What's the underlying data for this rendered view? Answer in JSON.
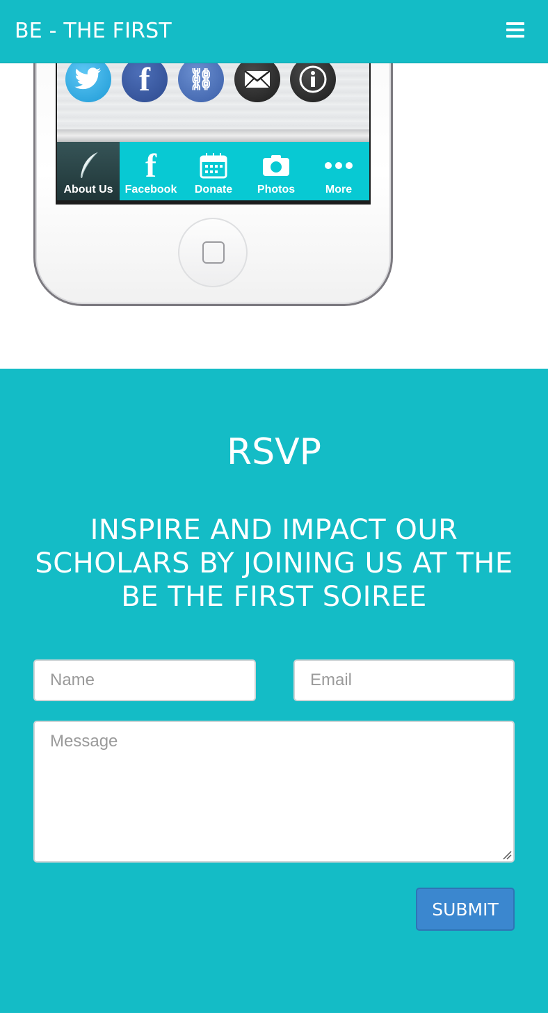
{
  "navbar": {
    "brand": "BE - THE FIRST",
    "menu_icon": "hamburger-menu-icon",
    "background": "#14bcc6"
  },
  "phone": {
    "share_icons": [
      "twitter-icon",
      "facebook-icon",
      "link-icon",
      "mail-icon",
      "info-icon"
    ],
    "tabs": [
      {
        "label": "About Us",
        "icon": "feather-icon",
        "active": true
      },
      {
        "label": "Facebook",
        "icon": "facebook-f-icon",
        "active": false
      },
      {
        "label": "Donate",
        "icon": "calendar-icon",
        "active": false
      },
      {
        "label": "Photos",
        "icon": "camera-icon",
        "active": false
      },
      {
        "label": "More",
        "icon": "more-dots-icon",
        "active": false
      }
    ]
  },
  "rsvp": {
    "title": "RSVP",
    "subtitle": "INSPIRE AND IMPACT OUR SCHOLARS BY JOINING US AT THE BE THE FIRST SOIREE",
    "name_placeholder": "Name",
    "email_placeholder": "Email",
    "message_placeholder": "Message",
    "submit_label": "SUBMIT",
    "accent": "#14bcc6",
    "button_color": "#3b87cf"
  }
}
